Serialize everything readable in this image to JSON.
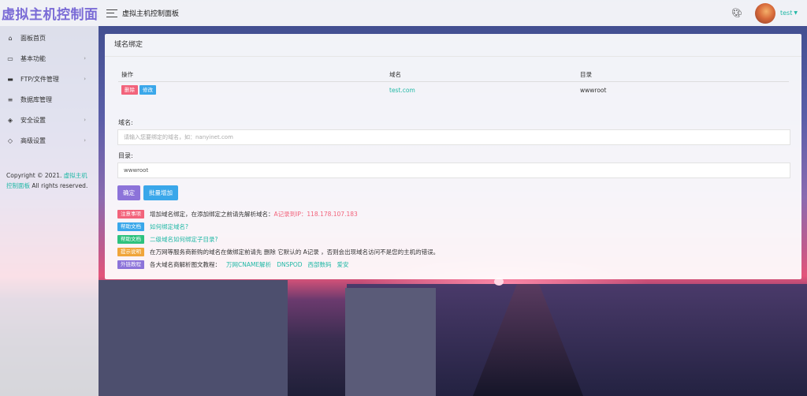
{
  "app": {
    "brand": "虚拟主机控制面板",
    "header_title": "虚拟主机控制面板",
    "user": "test",
    "palette_icon": "palette-icon",
    "accent_color": "#21b8a6"
  },
  "sidebar": {
    "items": [
      {
        "label": "面板首页",
        "icon": "home-icon"
      },
      {
        "label": "基本功能",
        "icon": "monitor-icon"
      },
      {
        "label": "FTP/文件管理",
        "icon": "folder-icon"
      },
      {
        "label": "数据库管理",
        "icon": "database-icon"
      },
      {
        "label": "安全设置",
        "icon": "shield-icon"
      },
      {
        "label": "高级设置",
        "icon": "diamond-icon"
      }
    ],
    "copyright_prefix": "Copyright © 2021.",
    "copyright_link": "虚拟主机控制面板",
    "copyright_suffix": "All rights reserved."
  },
  "panel": {
    "title": "域名绑定",
    "table": {
      "headers": [
        "操作",
        "域名",
        "目录"
      ],
      "rows": [
        {
          "delete_label": "删除",
          "edit_label": "修改",
          "domain": "test.com",
          "dir": "wwwroot"
        }
      ]
    },
    "domain_field": {
      "label": "域名:",
      "placeholder": "请输入您要绑定的域名，如：nanyinet.com",
      "value": ""
    },
    "dir_field": {
      "label": "目录:",
      "value": "wwwroot"
    },
    "confirm_label": "确定",
    "batch_label": "批量增加",
    "tips": {
      "notice_tag": "注意事项",
      "notice_text": "增加域名绑定，在添加绑定之前请先解析域名：",
      "notice_ip": "A记录到IP：118.178.107.183",
      "help1_tag": "帮助文档",
      "help1_link": "如何绑定域名?",
      "help2_tag": "帮助文档",
      "help2_link": "二级域名如何绑定子目录?",
      "hint_tag": "提示说明",
      "hint_text": "在万网等服务商新购的域名在做绑定前请先 删除 它默认的 A记录 ，否则会出现域名访问不是您的主机的错误。",
      "ext_tag": "外链教程",
      "ext_text": "各大域名商解析图文教程：",
      "ext_links": [
        "万网CNAME解析",
        "DNSPOD",
        "西部数码",
        "爱安"
      ]
    }
  }
}
